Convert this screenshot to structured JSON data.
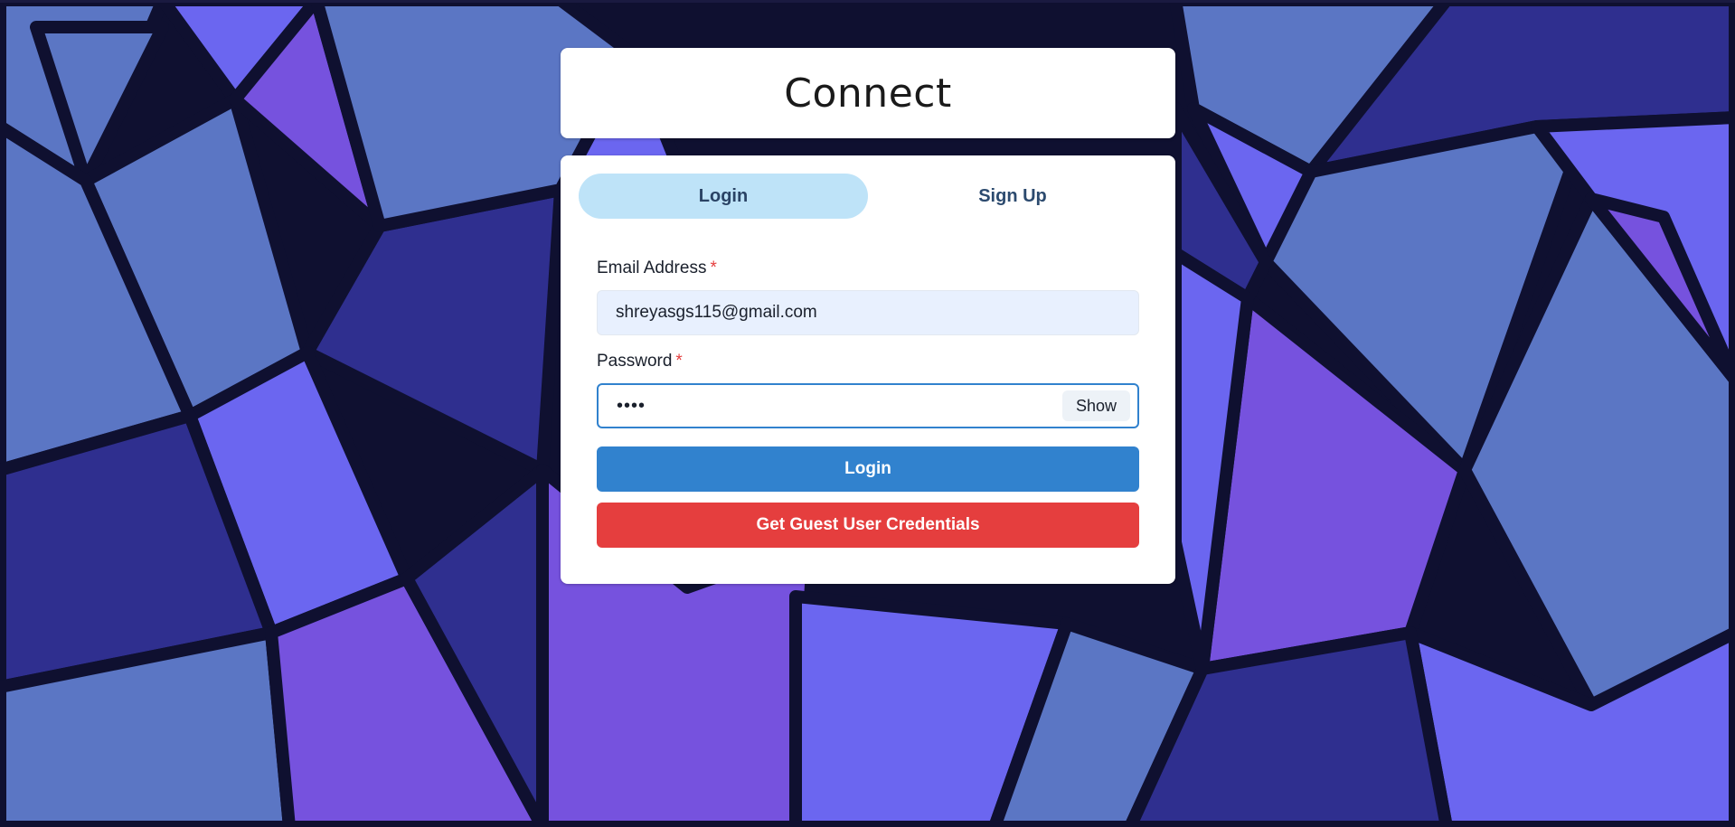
{
  "app": {
    "title": "Connect"
  },
  "tabs": [
    {
      "label": "Login",
      "active": true
    },
    {
      "label": "Sign Up",
      "active": false
    }
  ],
  "form": {
    "email": {
      "label": "Email Address",
      "required_mark": "*",
      "value": "shreyasgs115@gmail.com"
    },
    "password": {
      "label": "Password",
      "required_mark": "*",
      "masked_value": "••••",
      "toggle_label": "Show"
    },
    "submit_label": "Login",
    "guest_label": "Get Guest User Credentials"
  },
  "colors": {
    "accent": "#3182ce",
    "danger": "#e53e3e",
    "active_tab": "#bee3f8",
    "background_dark": "#0f1030"
  }
}
